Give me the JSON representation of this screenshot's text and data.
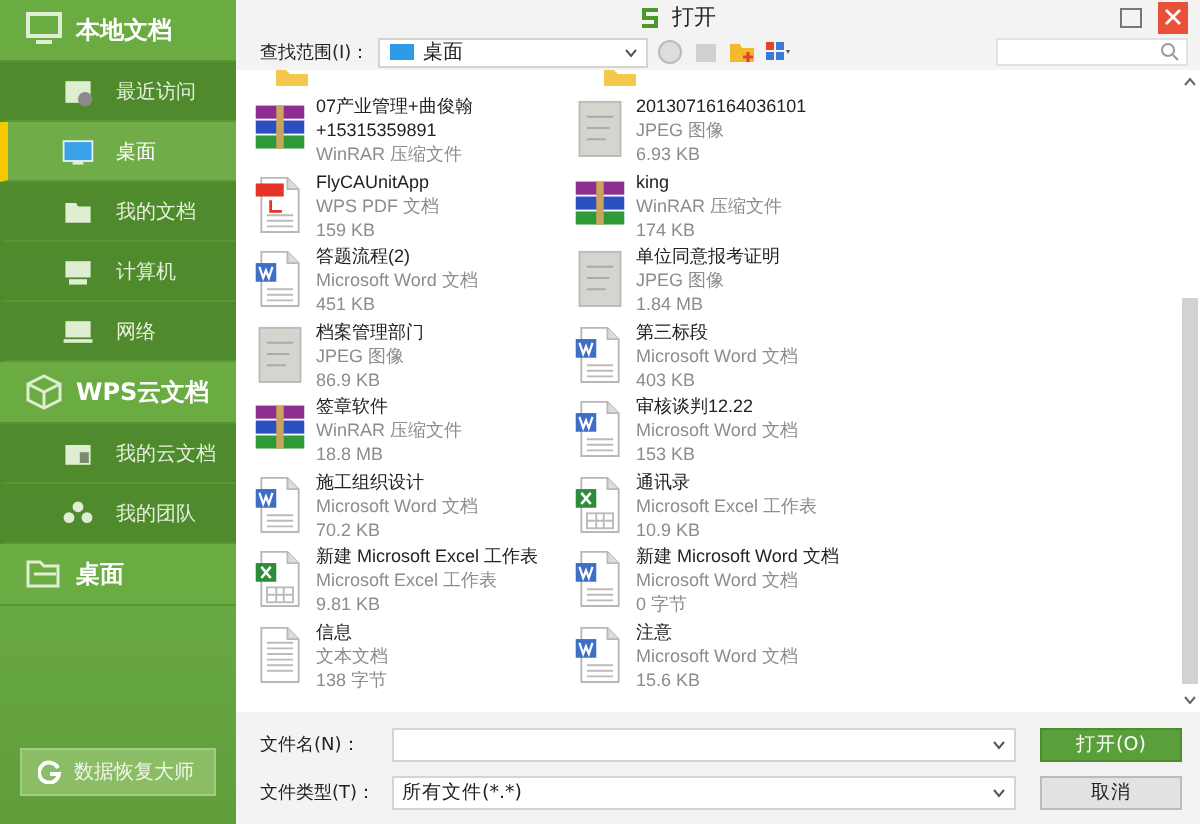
{
  "window": {
    "title": "打开"
  },
  "sidebar": {
    "sections": [
      {
        "label": "本地文档",
        "items": [
          {
            "label": "最近访问",
            "selected": false
          },
          {
            "label": "桌面",
            "selected": true
          },
          {
            "label": "我的文档",
            "selected": false
          },
          {
            "label": "计算机",
            "selected": false
          },
          {
            "label": "网络",
            "selected": false
          }
        ]
      },
      {
        "label": "WPS云文档",
        "items": [
          {
            "label": "我的云文档",
            "selected": false
          },
          {
            "label": "我的团队",
            "selected": false
          }
        ]
      },
      {
        "label": "桌面"
      }
    ],
    "recover_button": "数据恢复大师"
  },
  "toolbar": {
    "look_in_label": "查找范围(I)：",
    "look_in_value": "桌面"
  },
  "files": [
    {
      "kind": "rar",
      "name": "07产业管理+曲俊翰+15315359891",
      "type": "WinRAR 压缩文件"
    },
    {
      "kind": "jpeg",
      "name": "20130716164036101",
      "type": "JPEG 图像",
      "size": "6.93 KB"
    },
    {
      "kind": "pdf",
      "name": "FlyCAUnitApp",
      "type": "WPS PDF 文档",
      "size": "159 KB"
    },
    {
      "kind": "rar",
      "name": "king",
      "type": "WinRAR 压缩文件",
      "size": "174 KB"
    },
    {
      "kind": "word",
      "name": "答题流程(2)",
      "type": "Microsoft Word 文档",
      "size": "451 KB"
    },
    {
      "kind": "jpeg",
      "name": "单位同意报考证明",
      "type": "JPEG 图像",
      "size": "1.84 MB"
    },
    {
      "kind": "jpeg",
      "name": "档案管理部门",
      "type": "JPEG 图像",
      "size": "86.9 KB"
    },
    {
      "kind": "word",
      "name": "第三标段",
      "type": "Microsoft Word 文档",
      "size": "403 KB"
    },
    {
      "kind": "rar",
      "name": "签章软件",
      "type": "WinRAR 压缩文件",
      "size": "18.8 MB"
    },
    {
      "kind": "word",
      "name": "审核谈判12.22",
      "type": "Microsoft Word 文档",
      "size": "153 KB"
    },
    {
      "kind": "word",
      "name": "施工组织设计",
      "type": "Microsoft Word 文档",
      "size": "70.2 KB"
    },
    {
      "kind": "excel",
      "name": "通讯录",
      "type": "Microsoft Excel 工作表",
      "size": "10.9 KB"
    },
    {
      "kind": "excel",
      "name": "新建 Microsoft Excel 工作表",
      "type": "Microsoft Excel 工作表",
      "size": "9.81 KB"
    },
    {
      "kind": "word",
      "name": "新建 Microsoft Word 文档",
      "type": "Microsoft Word 文档",
      "size": "0 字节"
    },
    {
      "kind": "txt",
      "name": "信息",
      "type": "文本文档",
      "size": "138 字节"
    },
    {
      "kind": "word",
      "name": "注意",
      "type": "Microsoft Word 文档",
      "size": "15.6 KB"
    }
  ],
  "footer": {
    "filename_label": "文件名(N)：",
    "filetype_label": "文件类型(T)：",
    "filetype_value": "所有文件(*.*)",
    "buttons": [
      {
        "label": "打开(O)",
        "kind": "primary"
      },
      {
        "label": "取消",
        "kind": "secondary"
      }
    ]
  }
}
